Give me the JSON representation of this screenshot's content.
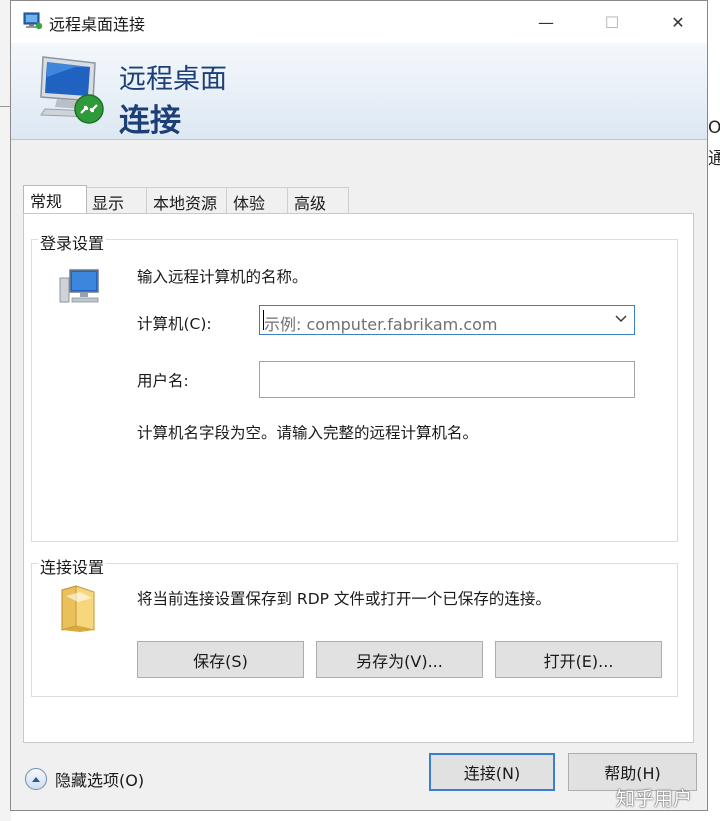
{
  "window": {
    "title": "远程桌面连接",
    "minimize_symbol": "—",
    "maximize_symbol": "☐",
    "close_symbol": "✕"
  },
  "banner": {
    "line1": "远程桌面",
    "line2": "连接"
  },
  "background_fragments": [
    "O",
    "通"
  ],
  "tabs": [
    {
      "label": "常规",
      "active": true
    },
    {
      "label": "显示",
      "active": false
    },
    {
      "label": "本地资源",
      "active": false
    },
    {
      "label": "体验",
      "active": false
    },
    {
      "label": "高级",
      "active": false
    }
  ],
  "login": {
    "group_title": "登录设置",
    "prompt": "输入远程计算机的名称。",
    "computer_label": "计算机(C):",
    "computer_placeholder": "示例: computer.fabrikam.com",
    "username_label": "用户名:",
    "username_value": "",
    "hint": "计算机名字段为空。请输入完整的远程计算机名。"
  },
  "connection": {
    "group_title": "连接设置",
    "description": "将当前连接设置保存到 RDP 文件或打开一个已保存的连接。",
    "save_label": "保存(S)",
    "save_as_label": "另存为(V)...",
    "open_label": "打开(E)..."
  },
  "footer": {
    "hide_options_label": "隐藏选项(O)",
    "connect_label": "连接(N)",
    "help_label": "帮助(H)"
  },
  "watermark": "知乎用户",
  "icons": {
    "title": "remote-desktop-icon",
    "banner": "remote-desktop-large-icon",
    "login": "computer-icon",
    "connection": "folder-icon",
    "options": "chevron-up-icon",
    "dropdown": "chevron-down-icon"
  },
  "colors": {
    "banner_text": "#1d3f78",
    "focus_border": "#3b7fc4",
    "primary_border": "#3a7ed1",
    "button_bg": "#e1e1e1"
  }
}
